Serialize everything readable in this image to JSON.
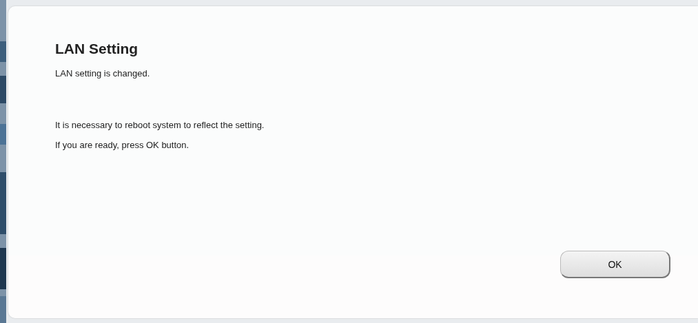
{
  "dialog": {
    "title": "LAN Setting",
    "status_text": "LAN setting is changed.",
    "instructions": [
      "It is necessary to reboot system to reflect the setting.",
      "If you are ready, press OK button."
    ],
    "buttons": [
      "OK"
    ]
  }
}
